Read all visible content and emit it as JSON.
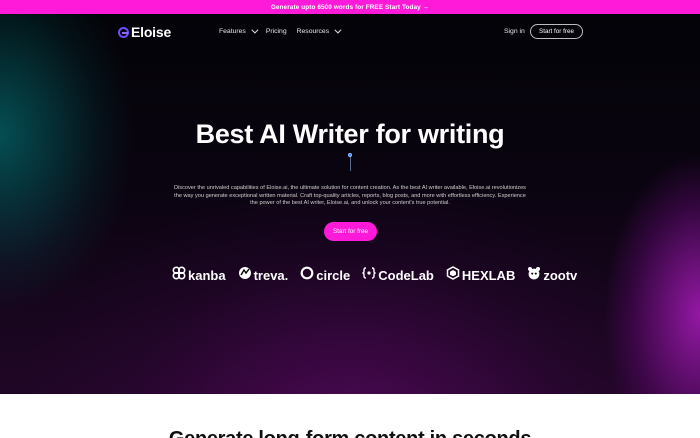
{
  "promo": {
    "text": "Generate upto 6500 words for FREE Start Today →"
  },
  "nav": {
    "logo_text": "Eloise",
    "menu": [
      {
        "label": "Features",
        "has_dropdown": true
      },
      {
        "label": "Pricing",
        "has_dropdown": false
      },
      {
        "label": "Resources",
        "has_dropdown": true
      }
    ],
    "signin_label": "Sign in",
    "start_label": "Start for free"
  },
  "hero": {
    "title": "Best AI Writer for writing",
    "description": "Discover the unrivaled capabilities of Eloise.ai, the ultimate solution for content creation. As the best AI writer available, Eloise.ai revolutionizes the way you generate exceptional written material. Craft top-quality articles, reports, blog posts, and more with effortless efficiency. Experience the power of the best AI writer, Eloise.ai, and unlock your content's true potential.",
    "cta_label": "Start for free"
  },
  "brands": [
    {
      "name": "kanba",
      "icon": "kanba-icon"
    },
    {
      "name": "treva.",
      "icon": "treva-icon"
    },
    {
      "name": "circle",
      "icon": "circle-icon"
    },
    {
      "name": "CodeLab",
      "icon": "codelab-icon"
    },
    {
      "name": "HEXLAB",
      "icon": "hexlab-icon"
    },
    {
      "name": "zootv",
      "icon": "zootv-icon"
    }
  ],
  "section2": {
    "title": "Generate long-form content in seconds"
  },
  "colors": {
    "accent": "#ff1ad9",
    "logo": "#6b4dff",
    "background": "#000000"
  }
}
